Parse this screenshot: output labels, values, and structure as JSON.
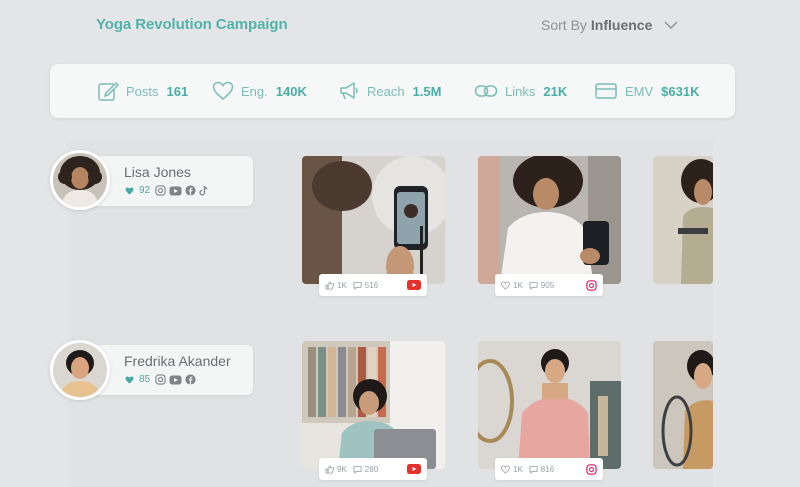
{
  "campaign": {
    "title": "Yoga Revolution Campaign"
  },
  "sort": {
    "label": "Sort By",
    "value": "Influence",
    "icon": "chevron-down-icon"
  },
  "stats": [
    {
      "label": "Posts",
      "value": "161",
      "icon": "edit-icon"
    },
    {
      "label": "Eng.",
      "value": "140K",
      "icon": "heart-icon"
    },
    {
      "label": "Reach",
      "value": "1.5M",
      "icon": "megaphone-icon"
    },
    {
      "label": "Links",
      "value": "21K",
      "icon": "link-icon"
    },
    {
      "label": "EMV",
      "value": "$631K",
      "icon": "card-icon"
    }
  ],
  "influencers": [
    {
      "name": "Lisa Jones",
      "score": "92",
      "socials": [
        "instagram",
        "youtube",
        "facebook",
        "tiktok"
      ],
      "posts": [
        {
          "likes": "1K",
          "comments": "516",
          "platform": "youtube"
        },
        {
          "likes": "1K",
          "comments": "905",
          "platform": "instagram"
        }
      ]
    },
    {
      "name": "Fredrika Akander",
      "score": "85",
      "socials": [
        "instagram",
        "youtube",
        "facebook"
      ],
      "posts": [
        {
          "likes": "9K",
          "comments": "280",
          "platform": "youtube"
        },
        {
          "likes": "1K",
          "comments": "816",
          "platform": "instagram"
        }
      ]
    }
  ],
  "colors": {
    "accent": "#52b3ab",
    "youtube": "#e5322d",
    "instagram": "#e1306c"
  }
}
